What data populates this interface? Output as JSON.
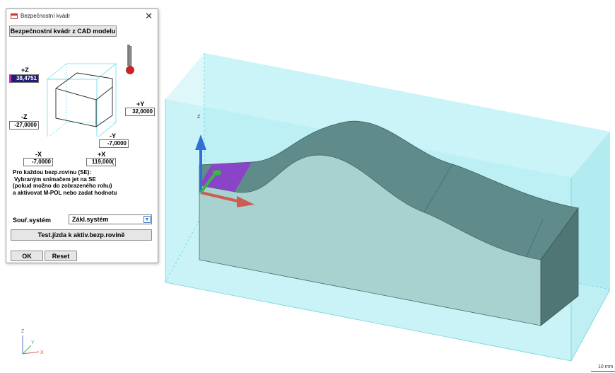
{
  "dialog": {
    "title": "Bezpečnostní kvádr",
    "cad_button": "Bezpečnostní kvádr z CAD modelu",
    "z_plus_label": "+Z",
    "z_plus_value": "38,4751",
    "z_minus_label": "-Z",
    "z_minus_value": "-27,0000",
    "y_plus_label": "+Y",
    "y_plus_value": "32,0000",
    "y_minus_label": "-Y",
    "y_minus_value": "-7,0000",
    "x_minus_label": "-X",
    "x_minus_value": "-7,0000",
    "x_plus_label": "+X",
    "x_plus_value": "119,000(",
    "info_lines": [
      "Pro každou bezp.rovinu (SE):",
      "Vybraným snímačem jet na SE",
      "(pokud možno do zobrazeného rohu)",
      "a aktivovat M-POL nebo zadat hodnotu"
    ],
    "coord_label": "Souř.systém",
    "coord_value": "Zákl.systém",
    "test_button": "Test.jízda k aktiv.bezp.rovině",
    "ok_button": "OK",
    "reset_button": "Reset"
  },
  "viewport": {
    "axis_label_z": "Z",
    "mini_axes": {
      "z": "Z",
      "y": "Y",
      "x": "X"
    },
    "scale_text": "10 mm",
    "colors": {
      "safety_box": "#b8f0f3",
      "box_edge_blue": "#2a7de1",
      "part_top": "#5e8a88",
      "part_front": "#a8d2d0",
      "part_end": "#4f7473",
      "axis_z": "#2f6fd6",
      "axis_x": "#d05b50",
      "axis_y": "#3cb44b",
      "highlight_face": "#8a44c8"
    }
  }
}
